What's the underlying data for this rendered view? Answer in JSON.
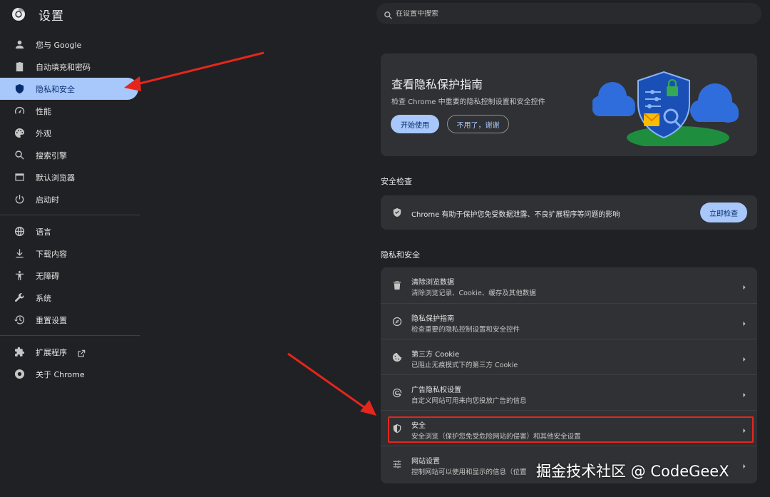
{
  "app": {
    "title": "设置"
  },
  "search": {
    "placeholder": "在设置中搜索"
  },
  "sidebar": {
    "items": [
      {
        "label": "您与 Google"
      },
      {
        "label": "自动填充和密码"
      },
      {
        "label": "隐私和安全",
        "active": true
      },
      {
        "label": "性能"
      },
      {
        "label": "外观"
      },
      {
        "label": "搜索引擎"
      },
      {
        "label": "默认浏览器"
      },
      {
        "label": "启动时"
      },
      {
        "label": "语言"
      },
      {
        "label": "下载内容"
      },
      {
        "label": "无障碍"
      },
      {
        "label": "系统"
      },
      {
        "label": "重置设置"
      },
      {
        "label": "扩展程序"
      },
      {
        "label": "关于 Chrome"
      }
    ]
  },
  "privacy_guide": {
    "title": "查看隐私保护指南",
    "description": "检查 Chrome 中重要的隐私控制设置和安全控件",
    "start_label": "开始使用",
    "dismiss_label": "不用了，谢谢"
  },
  "safety_check": {
    "heading": "安全检查",
    "text": "Chrome 有助于保护您免受数据泄露、不良扩展程序等问题的影响",
    "button_label": "立即检查"
  },
  "privacy_section": {
    "heading": "隐私和安全",
    "rows": [
      {
        "title": "清除浏览数据",
        "subtitle": "清除浏览记录、Cookie、缓存及其他数据"
      },
      {
        "title": "隐私保护指南",
        "subtitle": "检查重要的隐私控制设置和安全控件"
      },
      {
        "title": "第三方 Cookie",
        "subtitle": "已阻止无痕模式下的第三方 Cookie"
      },
      {
        "title": "广告隐私权设置",
        "subtitle": "自定义网站可用来向您投放广告的信息"
      },
      {
        "title": "安全",
        "subtitle": "安全浏览（保护您免受危险网站的侵害）和其他安全设置"
      },
      {
        "title": "网站设置",
        "subtitle": "控制网站可以使用和显示的信息（位置"
      }
    ]
  },
  "watermark": "掘金技术社区 @ CodeGeeX",
  "colors": {
    "background": "#202124",
    "card": "#303134",
    "accent": "#a8c7fa",
    "highlight": "#e5261c"
  }
}
